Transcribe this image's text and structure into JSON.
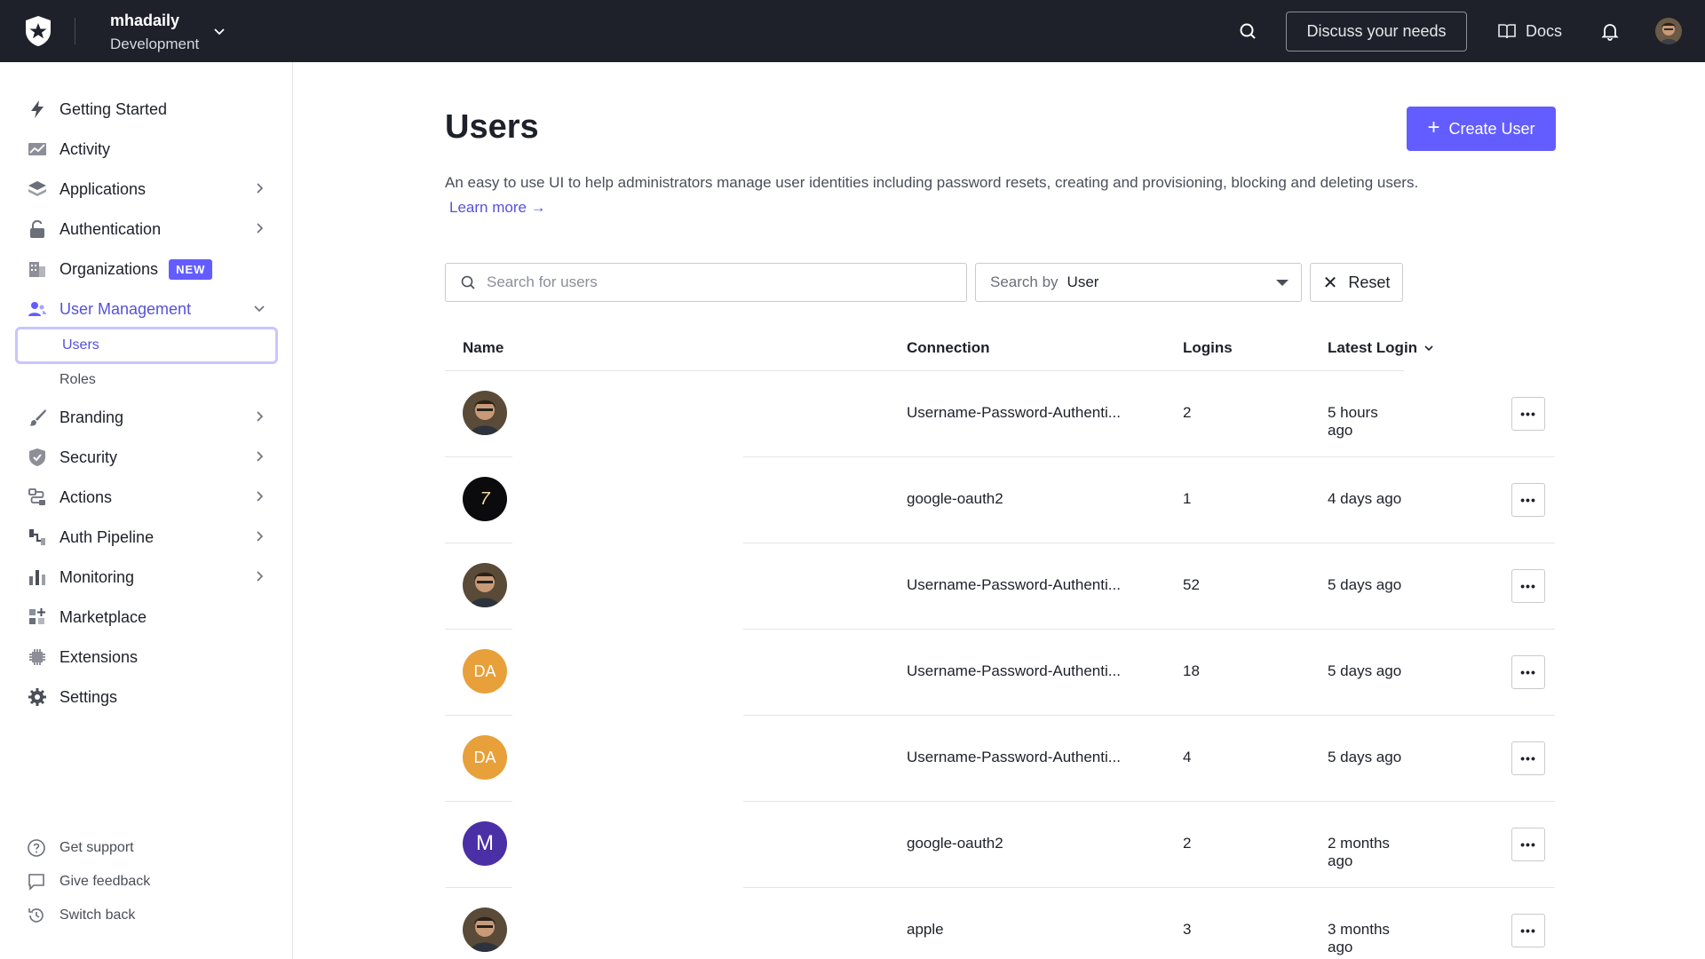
{
  "topbar": {
    "tenant_name": "mhadaily",
    "tenant_env": "Development",
    "discuss_label": "Discuss your needs",
    "docs_label": "Docs"
  },
  "sidebar": {
    "items": [
      {
        "label": "Getting Started",
        "icon": "bolt-icon"
      },
      {
        "label": "Activity",
        "icon": "chart-icon"
      },
      {
        "label": "Applications",
        "icon": "layers-icon"
      },
      {
        "label": "Authentication",
        "icon": "lock-icon"
      },
      {
        "label": "Organizations",
        "icon": "building-icon",
        "badge": "NEW"
      },
      {
        "label": "User Management",
        "icon": "users-icon"
      },
      {
        "label": "Branding",
        "icon": "brush-icon"
      },
      {
        "label": "Security",
        "icon": "shield-icon"
      },
      {
        "label": "Actions",
        "icon": "flow-icon"
      },
      {
        "label": "Auth Pipeline",
        "icon": "pipeline-icon"
      },
      {
        "label": "Monitoring",
        "icon": "bar-chart-icon"
      },
      {
        "label": "Marketplace",
        "icon": "grid-plus-icon"
      },
      {
        "label": "Extensions",
        "icon": "chip-icon"
      },
      {
        "label": "Settings",
        "icon": "gear-icon"
      }
    ],
    "sub_items": [
      "Users",
      "Roles"
    ],
    "footer": [
      "Get support",
      "Give feedback",
      "Switch back"
    ]
  },
  "main": {
    "title": "Users",
    "create_label": "Create User",
    "description": "An easy to use UI to help administrators manage user identities including password resets, creating and provisioning, blocking and deleting users.",
    "learn_more": "Learn more →",
    "search_placeholder": "Search for users",
    "search_by_label": "Search by",
    "search_by_value": "User",
    "reset_label": "Reset",
    "columns": [
      "Name",
      "Connection",
      "Logins",
      "Latest Login"
    ]
  },
  "users": [
    {
      "avatar": "photo",
      "connection": "Username-Password-Authenti...",
      "logins": "2",
      "latest": "5 hours ago"
    },
    {
      "avatar": "dark",
      "avatar_text": "7",
      "connection": "google-oauth2",
      "logins": "1",
      "latest": "4 days ago"
    },
    {
      "avatar": "photo",
      "connection": "Username-Password-Authenti...",
      "logins": "52",
      "latest": "5 days ago"
    },
    {
      "avatar": "initials",
      "avatar_text": "DA",
      "avatar_color": "#e8a03a",
      "connection": "Username-Password-Authenti...",
      "logins": "18",
      "latest": "5 days ago"
    },
    {
      "avatar": "initials",
      "avatar_text": "DA",
      "avatar_color": "#e8a03a",
      "connection": "Username-Password-Authenti...",
      "logins": "4",
      "latest": "5 days ago"
    },
    {
      "avatar": "initials",
      "avatar_text": "M",
      "avatar_color": "#4b2fa6",
      "connection": "google-oauth2",
      "logins": "2",
      "latest": "2 months ago"
    },
    {
      "avatar": "photo",
      "connection": "apple",
      "logins": "3",
      "latest": "3 months ago"
    }
  ],
  "colors": {
    "accent": "#635dff",
    "topbar": "#1e212a"
  }
}
